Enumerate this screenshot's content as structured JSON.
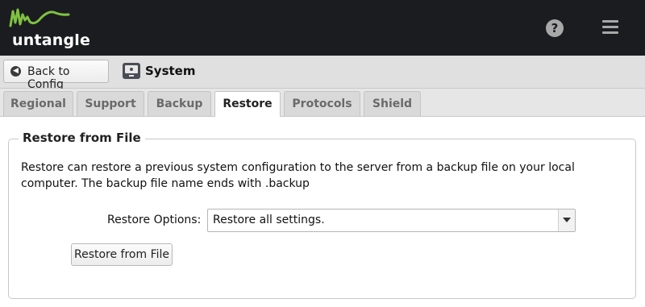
{
  "header": {
    "logo_text": "untangle",
    "accent_color": "#7fc241",
    "help_icon": "question-circle-icon",
    "help_glyph": "?",
    "menu_icon": "hamburger-menu-icon"
  },
  "toolbar": {
    "back_label": "Back to Config",
    "back_icon": "arrow-left-circle-icon",
    "back_glyph": "◀",
    "section_icon": "system-monitor-icon",
    "section_title": "System"
  },
  "tabs": [
    {
      "label": "Regional",
      "active": false
    },
    {
      "label": "Support",
      "active": false
    },
    {
      "label": "Backup",
      "active": false
    },
    {
      "label": "Restore",
      "active": true
    },
    {
      "label": "Protocols",
      "active": false
    },
    {
      "label": "Shield",
      "active": false
    }
  ],
  "restore": {
    "legend": "Restore from File",
    "description": "Restore can restore a previous system configuration to the server from a backup file on your local computer. The backup file name ends with .backup",
    "options_label": "Restore Options:",
    "options_value": "Restore all settings.",
    "button_label": "Restore from File"
  }
}
